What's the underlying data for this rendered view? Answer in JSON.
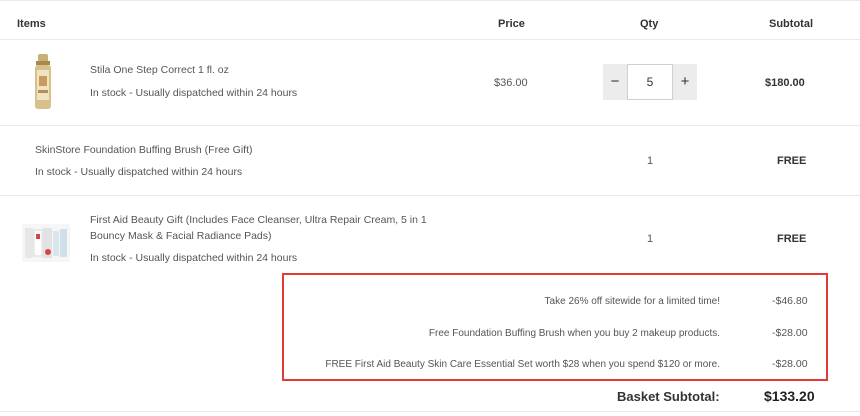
{
  "table_header": {
    "items": "Items",
    "price": "Price",
    "qty": "Qty",
    "subtotal": "Subtotal"
  },
  "lines": [
    {
      "name": "Stila One Step Correct 1 fl. oz",
      "stock": "In stock  -  Usually dispatched within 24 hours",
      "price": "$36.00",
      "qty": "5",
      "subtotal": "$180.00",
      "minus_label": "−",
      "plus_label": "+"
    },
    {
      "name": "SkinStore Foundation Buffing Brush (Free Gift)",
      "stock": "In stock  -  Usually dispatched within 24 hours",
      "qty": "1",
      "subtotal": "FREE"
    },
    {
      "name_line1": "First Aid Beauty Gift (Includes Face Cleanser, Ultra Repair Cream, 5 in 1",
      "name_line2": "Bouncy Mask & Facial Radiance Pads)",
      "stock": "In stock  -  Usually dispatched within 24 hours",
      "qty": "1",
      "subtotal": "FREE"
    }
  ],
  "promotions": [
    {
      "text": "Take 26% off sitewide for a limited time!",
      "amount": "-$46.80"
    },
    {
      "text": "Free Foundation Buffing Brush when you buy 2 makeup products.",
      "amount": "-$28.00"
    },
    {
      "text": "FREE First Aid Beauty Skin Care Essential Set worth $28 when you spend $120 or more.",
      "amount": "-$28.00"
    }
  ],
  "basket": {
    "label": "Basket Subtotal:",
    "value": "$133.20"
  },
  "colors": {
    "promo_border": "#e53935"
  }
}
